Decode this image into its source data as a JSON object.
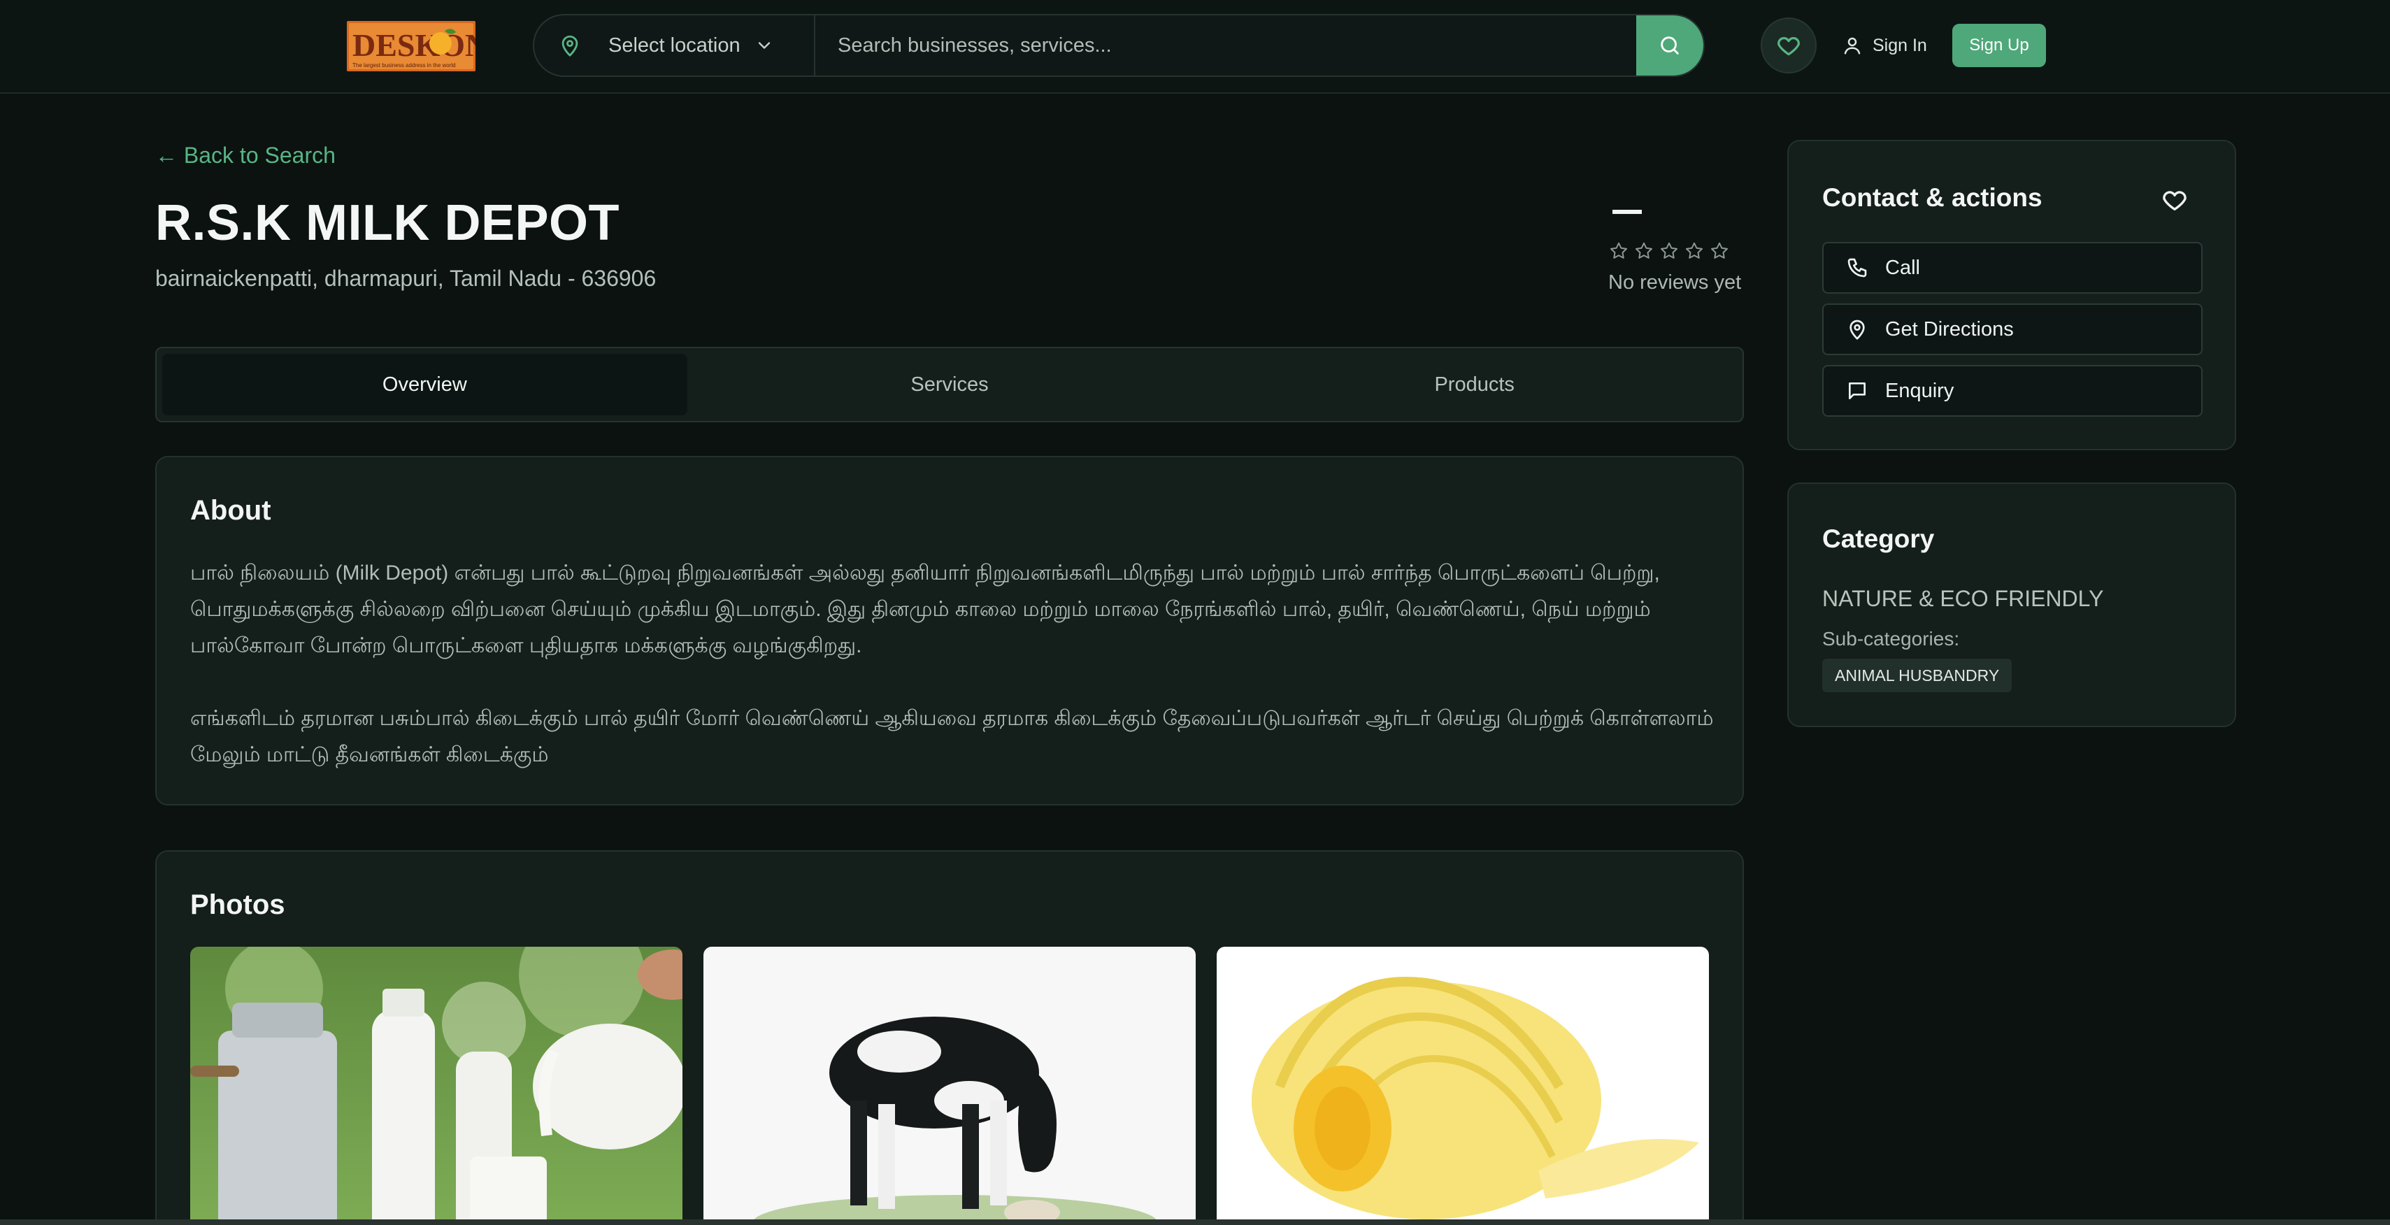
{
  "header": {
    "logo_text": "DESKON",
    "logo_tagline": "The largest business address in the world",
    "location_label": "Select location",
    "search_placeholder": "Search businesses, services...",
    "signin_label": "Sign In",
    "signup_label": "Sign Up"
  },
  "page": {
    "back_label": "← Back to Search",
    "title": "R.S.K MILK DEPOT",
    "address": "bairnaickenpatti, dharmapuri, Tamil Nadu - 636906",
    "rating_value": "—",
    "rating_stars": 0,
    "reviews_label": "No reviews yet"
  },
  "tabs": [
    {
      "label": "Overview",
      "active": true
    },
    {
      "label": "Services",
      "active": false
    },
    {
      "label": "Products",
      "active": false
    }
  ],
  "about": {
    "title": "About",
    "paragraphs": [
      "பால் நிலையம் (Milk Depot) என்பது பால் கூட்டுறவு நிறுவனங்கள் அல்லது தனியார் நிறுவனங்களிடமிருந்து பால் மற்றும் பால் சார்ந்த பொருட்களைப் பெற்று, பொதுமக்களுக்கு சில்லறை விற்பனை செய்யும் முக்கிய இடமாகும். இது தினமும் காலை மற்றும் மாலை நேரங்களில் பால், தயிர், வெண்ணெய், நெய் மற்றும் பால்கோவா போன்ற பொருட்களை புதியதாக மக்களுக்கு வழங்குகிறது.",
      "எங்களிடம் தரமான பசும்பால் கிடைக்கும் பால் தயிர் மோர் வெண்ணெய் ஆகியவை தரமாக கிடைக்கும் தேவைப்படுபவர்கள் ஆர்டர் செய்து பெற்றுக் கொள்ளலாம் மேலும் மாட்டு தீவனங்கள் கிடைக்கும்"
    ]
  },
  "photos": {
    "title": "Photos"
  },
  "contact": {
    "title": "Contact & actions",
    "call_label": "Call",
    "directions_label": "Get Directions",
    "enquiry_label": "Enquiry"
  },
  "category": {
    "title": "Category",
    "name": "NATURE & ECO FRIENDLY",
    "subcategories_label": "Sub-categories:",
    "subcategories": [
      "ANIMAL HUSBANDRY"
    ]
  },
  "colors": {
    "accent": "#4fa87a",
    "background": "#0b1210",
    "card": "#141e1b",
    "logo_orange": "#d9691f"
  }
}
